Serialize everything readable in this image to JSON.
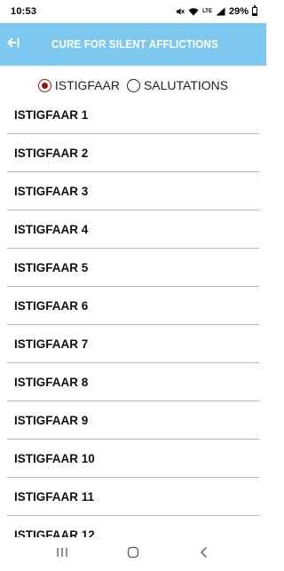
{
  "status_bar": {
    "time": "10:53",
    "battery": "29%",
    "network": "LTE"
  },
  "app_bar": {
    "title": "CURE FOR SILENT AFFLICTIONS",
    "back_icon": "back-arrow-icon",
    "background_color": "#7ec8f0"
  },
  "tabs": {
    "option1": "ISTIGFAAR",
    "option2": "SALUTATIONS",
    "selected": "ISTIGFAAR",
    "selected_color": "#8b1a1a"
  },
  "list": {
    "items": [
      "ISTIGFAAR 1",
      "ISTIGFAAR 2",
      "ISTIGFAAR 3",
      "ISTIGFAAR 4",
      "ISTIGFAAR 5",
      "ISTIGFAAR 6",
      "ISTIGFAAR 7",
      "ISTIGFAAR 8",
      "ISTIGFAAR 9",
      "ISTIGFAAR 10",
      "ISTIGFAAR 11",
      "ISTIGFAAR 12"
    ]
  },
  "nav_bar": {
    "recents_icon": "recents-icon",
    "home_icon": "home-icon",
    "back_icon": "back-chevron-icon"
  }
}
